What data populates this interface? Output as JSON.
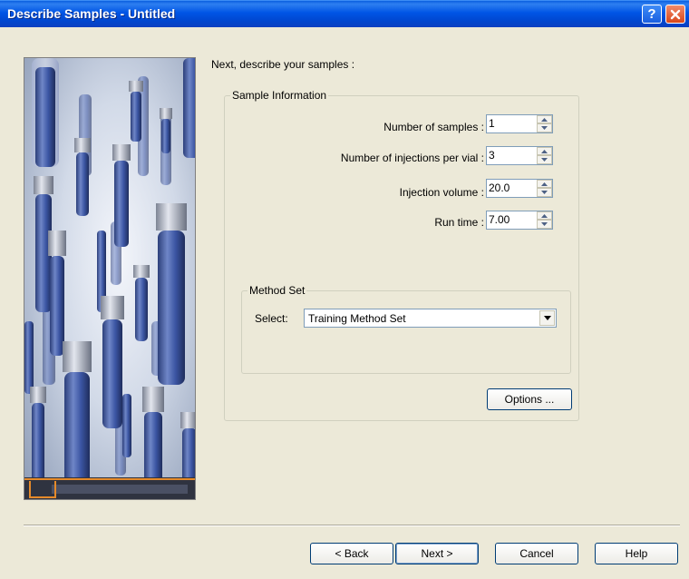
{
  "window": {
    "title": "Describe Samples - Untitled",
    "help_glyph": "?",
    "accent_color": "#0055e5"
  },
  "intro": "Next, describe your samples :",
  "sample_info": {
    "legend": "Sample Information",
    "fields": [
      {
        "label": "Number of samples :",
        "value": "1"
      },
      {
        "label": "Number of injections per vial :",
        "value": "3"
      },
      {
        "label": "Injection volume :",
        "value": "20.0"
      },
      {
        "label": "Run time :",
        "value": "7.00"
      }
    ]
  },
  "method_set": {
    "legend": "Method Set",
    "select_label": "Select:",
    "selected": "Training Method Set"
  },
  "options_button": "Options ...",
  "footer": {
    "back": "< Back",
    "next": "Next >",
    "cancel": "Cancel",
    "help": "Help"
  },
  "icons": {
    "help": "question-mark-icon",
    "close": "close-x-icon",
    "spin_up": "triangle-up-icon",
    "spin_down": "triangle-down-icon",
    "dropdown": "chevron-down-icon"
  }
}
